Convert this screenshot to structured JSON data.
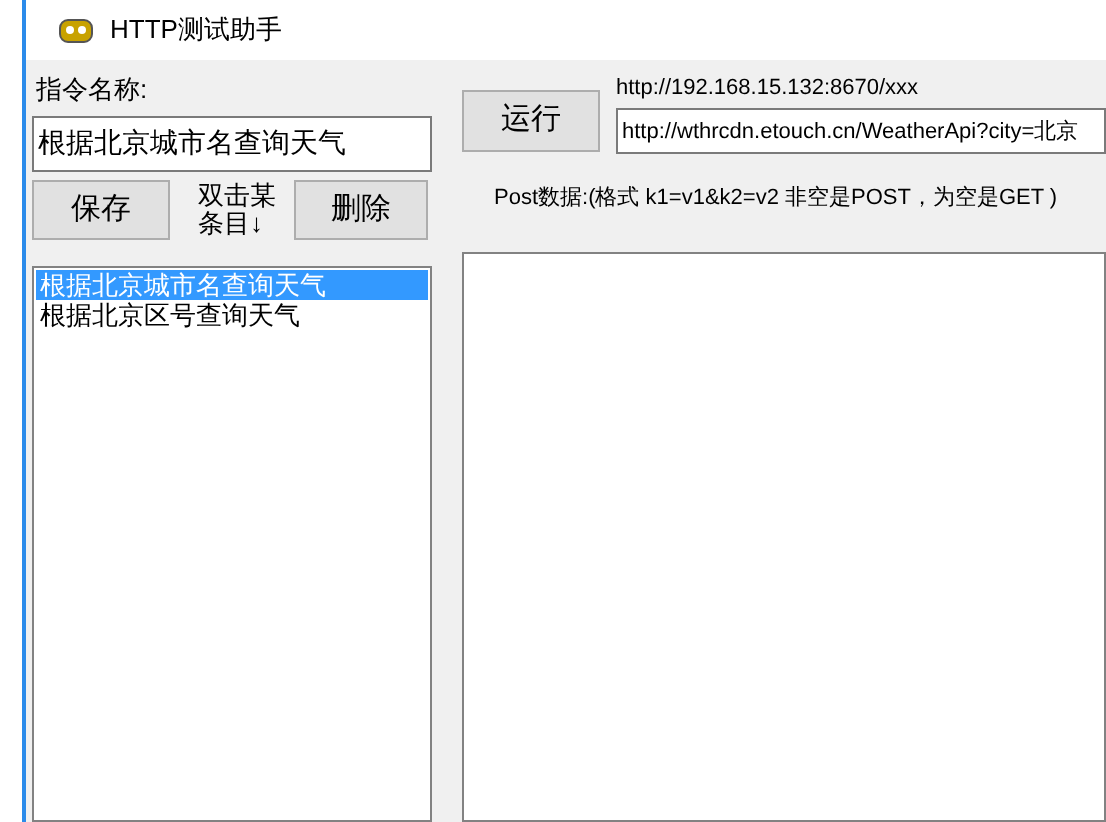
{
  "window": {
    "title": "HTTP测试助手"
  },
  "command_name": {
    "label": "指令名称:",
    "value": "根据北京城市名查询天气"
  },
  "buttons": {
    "save": "保存",
    "hint": "双击某条目↓",
    "delete": "删除",
    "run": "运行"
  },
  "commands": [
    {
      "label": "根据北京城市名查询天气",
      "selected": true
    },
    {
      "label": "根据北京区号查询天气",
      "selected": false
    }
  ],
  "url": {
    "label": "http://192.168.15.132:8670/xxx",
    "value": "http://wthrcdn.etouch.cn/WeatherApi?city=北京"
  },
  "post": {
    "label": "Post数据:(格式 k1=v1&k2=v2 非空是POST，为空是GET )"
  }
}
